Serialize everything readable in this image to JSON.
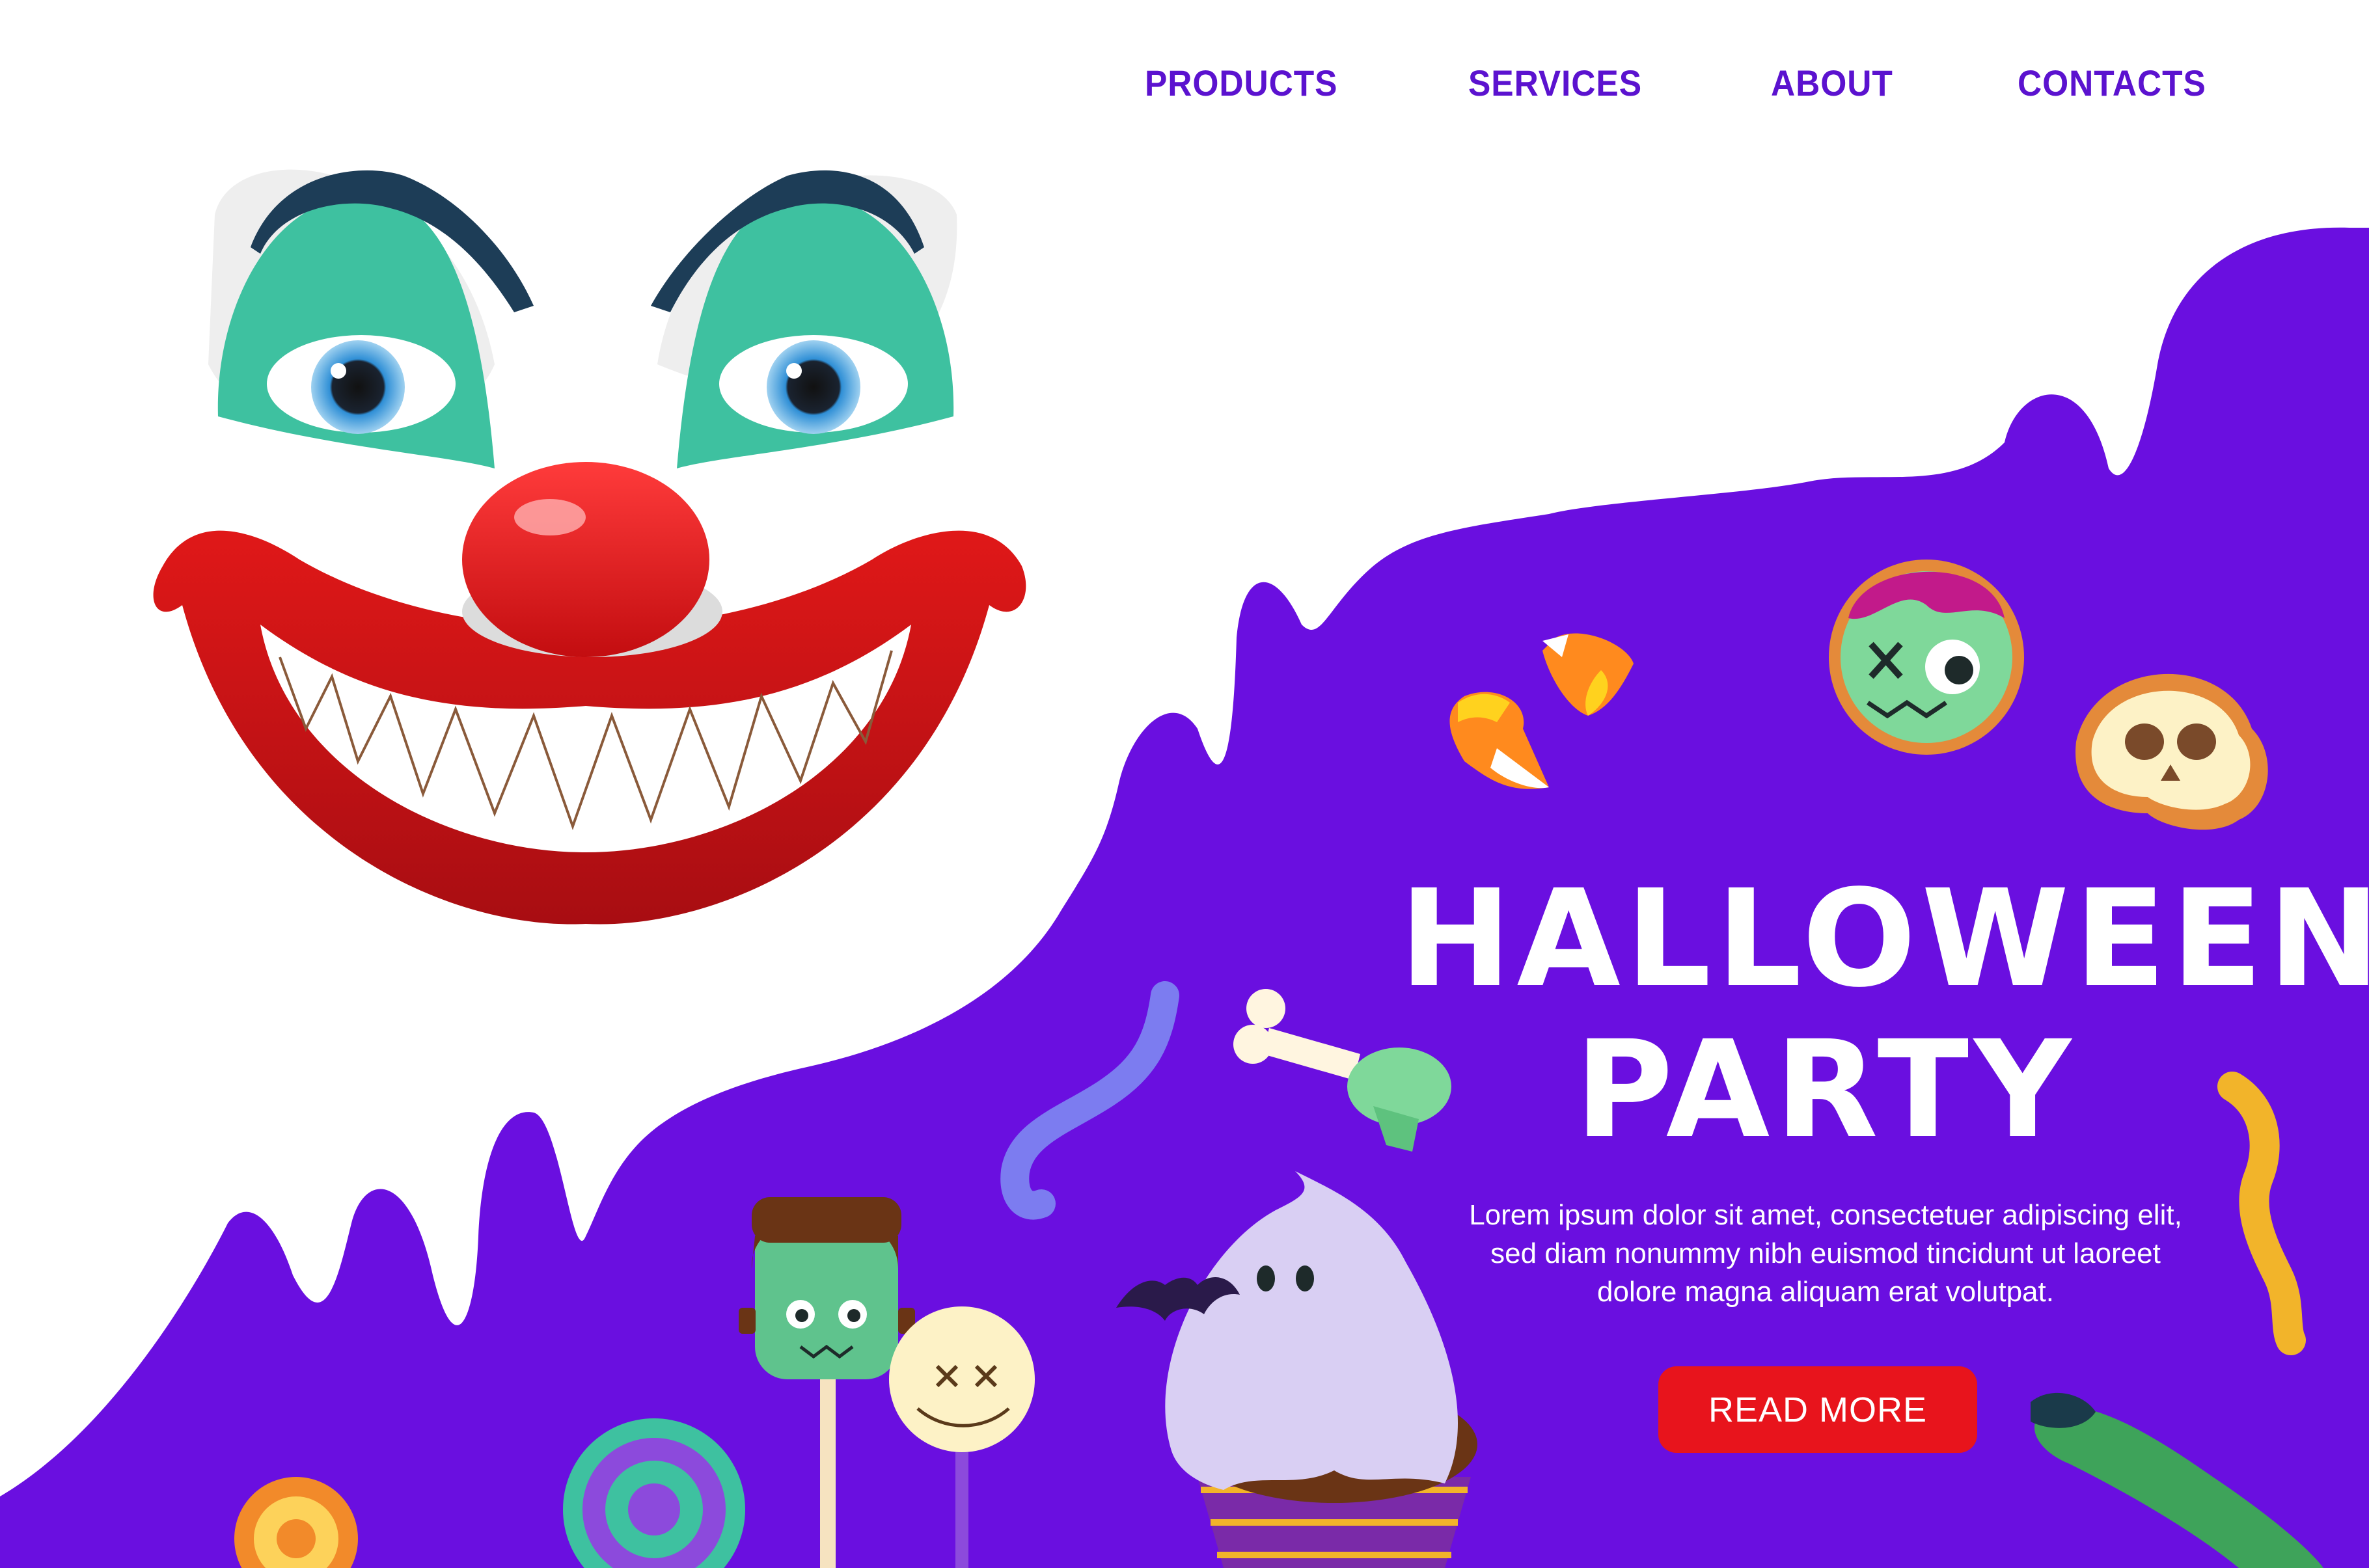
{
  "nav": {
    "items": [
      {
        "label": "PRODUCTS"
      },
      {
        "label": "SERVICES"
      },
      {
        "label": "ABOUT"
      },
      {
        "label": "CONTACTS"
      }
    ]
  },
  "hero": {
    "title_line1": "HALLOWEEN",
    "title_line2": "PARTY",
    "body": "Lorem ipsum dolor sit amet, consectetuer adipiscing elit, sed diam nonummy nibh euismod tincidunt ut laoreet dolore magna aliquam erat volutpat.",
    "cta_label": "READ MORE"
  },
  "colors": {
    "nav_text": "#5b12cf",
    "slime": "#6a0fe0",
    "cta": "#e8141c",
    "background": "#ffffff"
  },
  "illustrations": [
    "clown-face-icon",
    "candy-corn-icon",
    "zombie-cookie-icon",
    "skull-cookie-icon",
    "gummy-worm-icon",
    "bone-candy-icon",
    "frankenstein-cake-pop-icon",
    "voodoo-cake-pop-icon",
    "ghost-cupcake-icon",
    "lollipop-icon",
    "swirl-candy-icon",
    "witch-finger-icon",
    "bat-icon"
  ]
}
